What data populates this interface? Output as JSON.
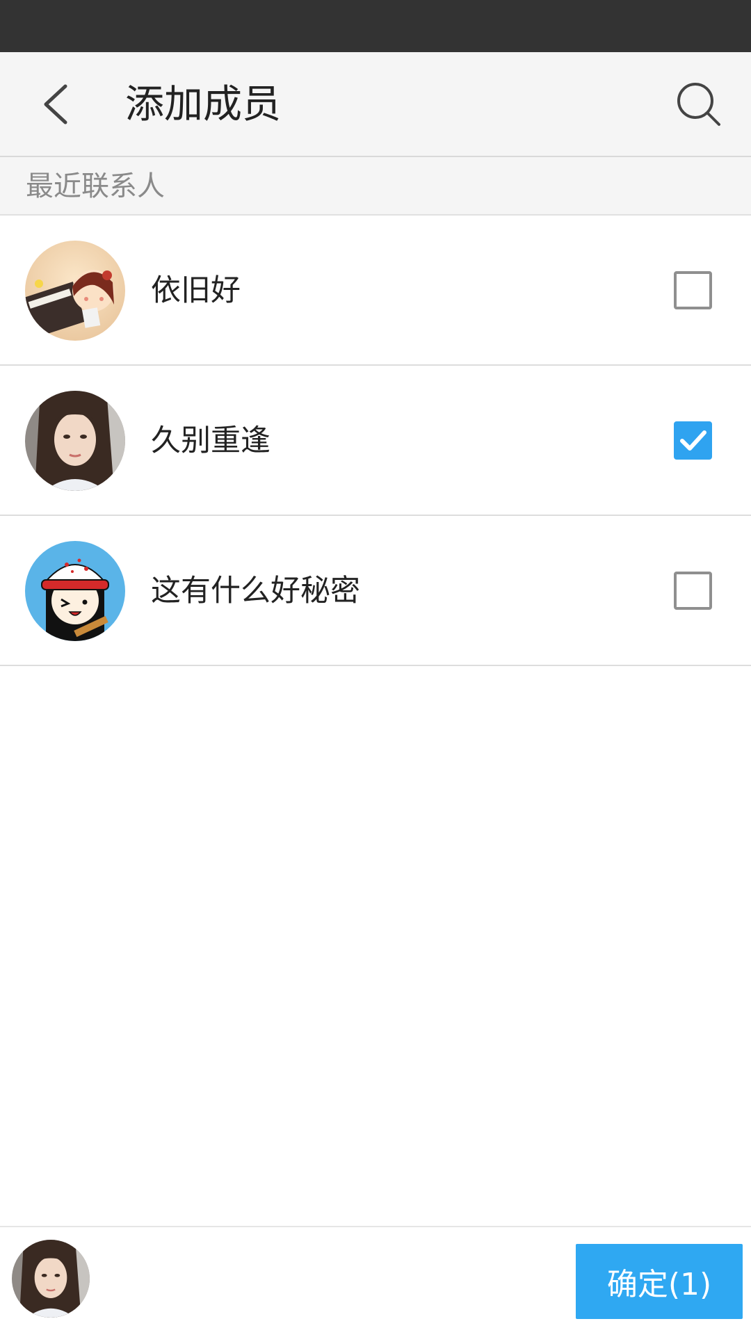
{
  "header": {
    "title": "添加成员",
    "back_icon": "chevron-left-icon",
    "search_icon": "search-icon"
  },
  "section": {
    "label": "最近联系人"
  },
  "contacts": [
    {
      "name": "依旧好",
      "checked": false,
      "avatar": "cartoon-girl-piano-avatar"
    },
    {
      "name": "久别重逢",
      "checked": true,
      "avatar": "woman-photo-avatar"
    },
    {
      "name": "这有什么好秘密",
      "checked": false,
      "avatar": "cartoon-girl-red-cap-avatar"
    }
  ],
  "bottom": {
    "selected_avatar": "woman-photo-avatar",
    "confirm_label": "确定(1)"
  },
  "colors": {
    "accent": "#2fa8f2",
    "status_bar": "#333333",
    "app_bar": "#f5f5f5"
  }
}
